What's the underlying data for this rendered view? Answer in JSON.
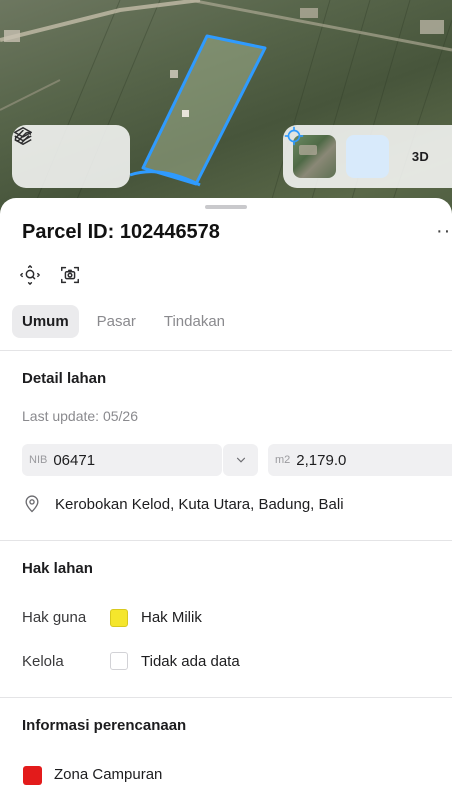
{
  "map": {
    "layers_icon": "layers-icon",
    "draw_icon": "draw-icon",
    "basemap_icon": "satellite-thumbnail",
    "locate_icon": "crosshair-icon",
    "mode_3d_label": "3D"
  },
  "parcel": {
    "title": "Parcel ID: 102446578",
    "more_label": "···",
    "zoom_icon": "zoom-to-parcel-icon",
    "screenshot_icon": "camera-capture-icon"
  },
  "tabs": [
    {
      "label": "Umum",
      "active": true
    },
    {
      "label": "Pasar",
      "active": false
    },
    {
      "label": "Tindakan",
      "active": false
    }
  ],
  "detail": {
    "section_title": "Detail lahan",
    "last_update": "Last update: 05/26",
    "nib_prefix": "NIB",
    "nib_value": "06471",
    "area_prefix": "m2",
    "area_value": "2,179.0",
    "location": "Kerobokan Kelod, Kuta Utara, Badung, Bali"
  },
  "rights": {
    "section_title": "Hak lahan",
    "rows": [
      {
        "label": "Hak guna",
        "value": "Hak Milik",
        "color": "#f5e62c"
      },
      {
        "label": "Kelola",
        "value": "Tidak ada data",
        "color": "#ffffff"
      }
    ]
  },
  "planning": {
    "section_title": "Informasi perencanaan",
    "zone_label": "Zona Campuran",
    "zone_color": "#e31b1b"
  },
  "colors": {
    "parcel_outline": "#2f9bff",
    "tab_active_bg": "#ebebed",
    "locate_bg": "#d8eafb"
  }
}
